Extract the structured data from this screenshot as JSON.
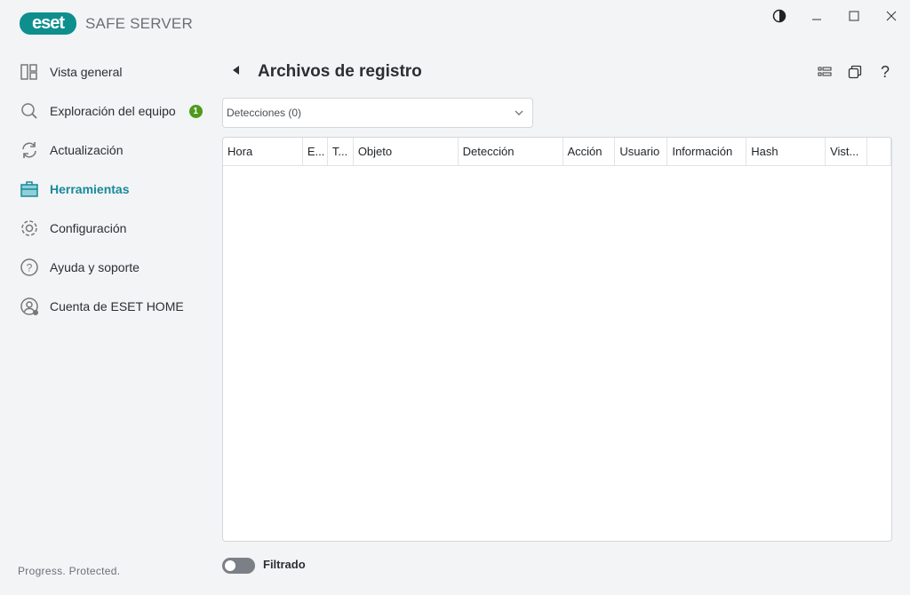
{
  "app": {
    "logo_text": "eset",
    "product_name": "SAFE SERVER",
    "brand_color": "#0e8f8e"
  },
  "sidebar": {
    "items": [
      {
        "label": "Vista general",
        "icon": "overview-icon"
      },
      {
        "label": "Exploración del equipo",
        "icon": "search-icon",
        "badge": "1"
      },
      {
        "label": "Actualización",
        "icon": "refresh-icon"
      },
      {
        "label": "Herramientas",
        "icon": "toolbox-icon",
        "active": true
      },
      {
        "label": "Configuración",
        "icon": "gear-icon"
      },
      {
        "label": "Ayuda y soporte",
        "icon": "help-icon"
      },
      {
        "label": "Cuenta de ESET HOME",
        "icon": "account-icon"
      }
    ],
    "footer": "Progress. Protected."
  },
  "main": {
    "title": "Archivos de registro",
    "log_select": "Detecciones (0)",
    "columns": [
      "Hora",
      "E...",
      "T...",
      "Objeto",
      "Detección",
      "Acción",
      "Usuario",
      "Información",
      "Hash",
      "Vist...",
      ""
    ],
    "filter_label": "Filtrado",
    "filter_on": false
  }
}
